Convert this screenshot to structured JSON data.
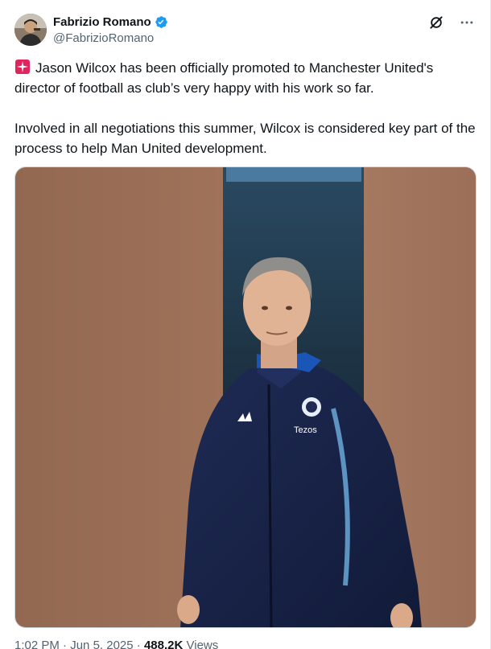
{
  "author": {
    "display_name": "Fabrizio Romano",
    "handle": "@FabrizioRomano"
  },
  "icons": {
    "verified": "verified-badge-icon",
    "grok": "grok-icon",
    "more": "more-icon",
    "siren": "siren-emoji-icon"
  },
  "tweet": {
    "paragraph_1": "Jason Wilcox has been officially promoted to Manchester United's director of football as club’s very happy with his work so far.",
    "paragraph_2": "Involved in all negotiations this summer, Wilcox is considered key part of the process to help Man United development."
  },
  "photo": {
    "jacket_sponsor": "Tezos"
  },
  "meta": {
    "time": "1:02 PM",
    "separator": "·",
    "date": "Jun 5, 2025",
    "views_count": "488.2K",
    "views_label": "Views"
  },
  "colors": {
    "verified": "#1d9bf0",
    "text": "#0f1419",
    "secondary": "#536471",
    "siren": "#e0245e"
  }
}
